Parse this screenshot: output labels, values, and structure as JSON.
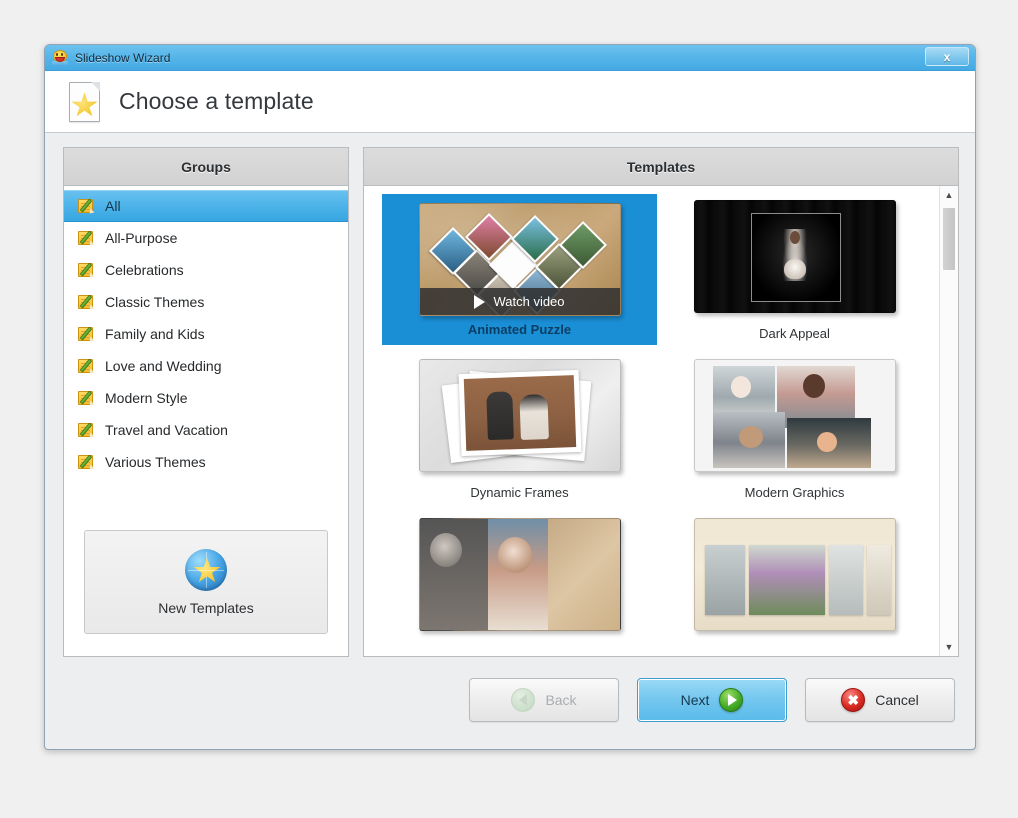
{
  "window": {
    "title": "Slideshow Wizard",
    "app_icon": "slideshow-app-icon",
    "close_label": "x",
    "titlebar_color": "#57b6e9"
  },
  "header": {
    "title": "Choose a template",
    "icon": "page-star-icon"
  },
  "groups_panel": {
    "heading": "Groups",
    "items": [
      {
        "label": "All",
        "icon": "folder-note-icon",
        "selected": true
      },
      {
        "label": "All-Purpose",
        "icon": "folder-note-icon",
        "selected": false
      },
      {
        "label": "Celebrations",
        "icon": "folder-note-icon",
        "selected": false
      },
      {
        "label": "Classic Themes",
        "icon": "folder-note-icon",
        "selected": false
      },
      {
        "label": "Family and Kids",
        "icon": "folder-note-icon",
        "selected": false
      },
      {
        "label": "Love and Wedding",
        "icon": "folder-note-icon",
        "selected": false
      },
      {
        "label": "Modern Style",
        "icon": "folder-note-icon",
        "selected": false
      },
      {
        "label": "Travel and Vacation",
        "icon": "folder-note-icon",
        "selected": false
      },
      {
        "label": "Various Themes",
        "icon": "folder-note-icon",
        "selected": false
      }
    ],
    "new_templates": {
      "label": "New Templates",
      "icon": "globe-star-icon"
    }
  },
  "templates_panel": {
    "heading": "Templates",
    "selection_color": "#1a8fd6",
    "items": [
      {
        "label": "Animated Puzzle",
        "selected": true,
        "overlay": "Watch video",
        "overlay_icon": "play-icon",
        "style": "puzzle"
      },
      {
        "label": "Dark Appeal",
        "selected": false,
        "style": "dark"
      },
      {
        "label": "Dynamic Frames",
        "selected": false,
        "style": "frames"
      },
      {
        "label": "Modern Graphics",
        "selected": false,
        "style": "modern"
      },
      {
        "label": "",
        "selected": false,
        "style": "love"
      },
      {
        "label": "",
        "selected": false,
        "style": "flowers"
      }
    ],
    "scrollbar": {
      "up_arrow": "▲",
      "down_arrow": "▼"
    }
  },
  "footer": {
    "back": {
      "label": "Back",
      "icon": "back-arrow-icon",
      "disabled": true
    },
    "next": {
      "label": "Next",
      "icon": "next-arrow-icon",
      "primary": true
    },
    "cancel": {
      "label": "Cancel",
      "icon": "cancel-x-icon"
    }
  }
}
